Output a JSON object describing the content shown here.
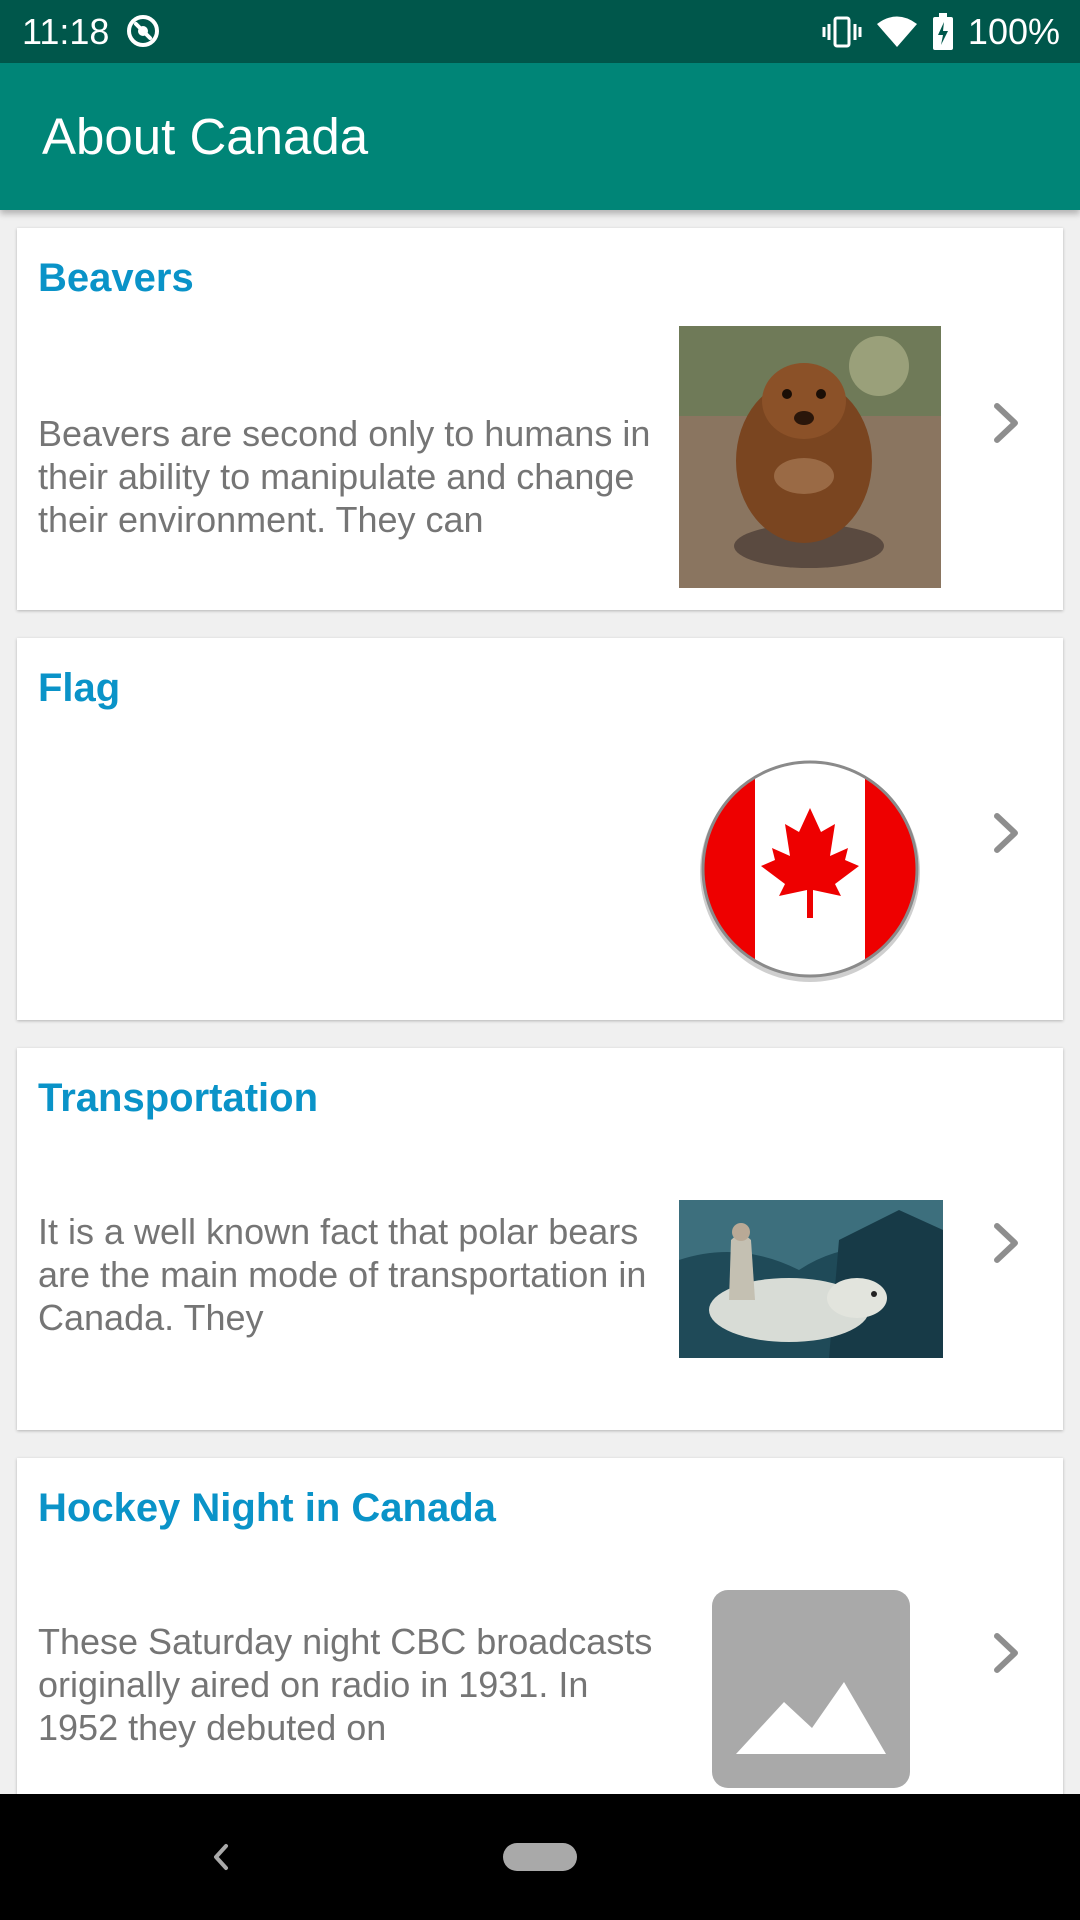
{
  "status_bar": {
    "time": "11:18",
    "battery": "100%",
    "icons": [
      "assistant-icon",
      "vibrate-icon",
      "wifi-icon",
      "battery-charging-icon"
    ]
  },
  "app_bar": {
    "title": "About Canada",
    "color": "#008577"
  },
  "cards": [
    {
      "title": "Beavers",
      "description": "Beavers are second only to humans in their ability to manipulate and change their environment. They can",
      "image": "beaver-photo"
    },
    {
      "title": "Flag",
      "description": "",
      "image": "canada-flag-icon"
    },
    {
      "title": "Transportation",
      "description": "It is a well known fact that polar bears are the main mode of transportation in Canada. They",
      "image": "polar-bear-rider-photo"
    },
    {
      "title": "Hockey Night in Canada",
      "description": "These Saturday night CBC broadcasts originally aired on radio in 1931. In 1952 they debuted on",
      "image": "image-placeholder-icon"
    }
  ],
  "colors": {
    "status_bar": "#00574b",
    "title_accent": "#0a93c8",
    "body_text": "#757575"
  }
}
